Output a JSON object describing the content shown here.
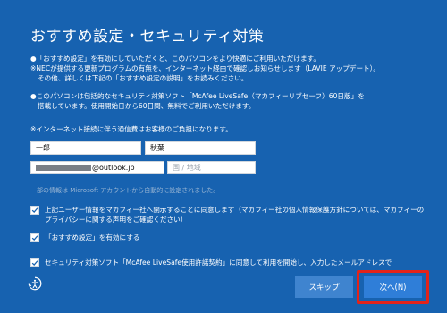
{
  "page": {
    "title": "おすすめ設定・セキュリティ対策",
    "intro_lines": [
      "●「おすすめ設定」を有効にしていただくと、このパソコンをより快適にご利用いただけます。",
      "※NECが提供する更新プログラムの有無を、インターネット経由で確認しお知らせします（LAVIE アップデート）。",
      "その他、詳しくは下記の「おすすめ設定の説明」をお読みください。"
    ],
    "security_lines": [
      "●このパソコンは包括的なセキュリティ対策ソフト「McAfee LiveSafe（マカフィーリブセーフ）60日版」を",
      "搭載しています。使用開始日から60日間、無料でご利用いただけます。"
    ],
    "notice": "※インターネット接続に伴う通信費はお客様のご負担になります。"
  },
  "form": {
    "last_name": "一郎",
    "first_name": "秋葉",
    "email_suffix": "@outlook.jp",
    "country_placeholder": "国 / 地域",
    "note": "一部の情報は Microsoft アカウントから自動的に設定されました。"
  },
  "checkboxes": [
    {
      "lines": [
        "上記ユーザー情報をマカフィー社へ開示することに同意します（マカフィー社の個人情報保護方針については、マカフィーの",
        "プライバシーに関する声明をご確認ください）"
      ],
      "checked": true
    },
    {
      "lines": [
        "「おすすめ設定」を有効にする"
      ],
      "checked": true
    },
    {
      "lines": [
        "セキュリティ対策ソフト「McAfee LiveSafe使用許諾契約」に同意して利用を開始し、入力したメールアドレスで"
      ],
      "checked": true
    }
  ],
  "buttons": {
    "skip": "スキップ",
    "next": "次へ(N)"
  },
  "icons": {
    "accessibility": "accessibility-icon",
    "check": "checkmark-icon"
  },
  "colors": {
    "background": "#1762b0",
    "button": "#2f7ed8",
    "highlight": "#e2231a"
  }
}
